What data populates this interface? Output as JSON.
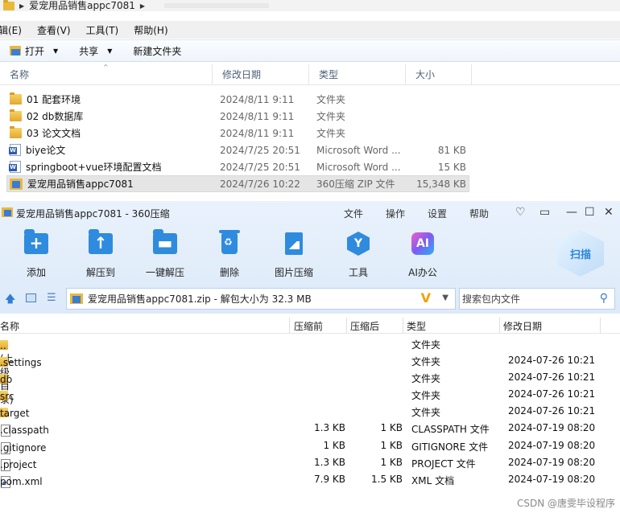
{
  "explorer": {
    "window_path": "爱宠用品销售appc7081",
    "menu": [
      "辑(E)",
      "查看(V)",
      "工具(T)",
      "帮助(H)"
    ],
    "toolbar": {
      "open": "打开",
      "share": "共享",
      "new_folder": "新建文件夹"
    },
    "columns": [
      "名称",
      "修改日期",
      "类型",
      "大小"
    ],
    "files": [
      {
        "name": "01 配套环境",
        "date": "2024/8/11 9:11",
        "type": "文件夹",
        "size": "",
        "icon": "folder-icon"
      },
      {
        "name": "02 db数据库",
        "date": "2024/8/11 9:11",
        "type": "文件夹",
        "size": "",
        "icon": "folder-icon"
      },
      {
        "name": "03 论文文档",
        "date": "2024/8/11 9:11",
        "type": "文件夹",
        "size": "",
        "icon": "folder-icon"
      },
      {
        "name": "biye论文",
        "date": "2024/7/25 20:51",
        "type": "Microsoft Word ...",
        "size": "81 KB",
        "icon": "word-doc-icon"
      },
      {
        "name": "springboot+vue环境配置文档",
        "date": "2024/7/25 20:51",
        "type": "Microsoft Word ...",
        "size": "15 KB",
        "icon": "word-doc-icon"
      },
      {
        "name": "爱宠用品销售appc7081",
        "date": "2024/7/26 10:22",
        "type": "360压缩 ZIP 文件",
        "size": "15,348 KB",
        "icon": "zip-archive-icon",
        "selected": true
      }
    ]
  },
  "zip": {
    "title": "爱宠用品销售appc7081 - 360压缩",
    "menu": [
      "文件",
      "操作",
      "设置",
      "帮助"
    ],
    "tools": [
      {
        "label": "添加",
        "icon": "add-icon"
      },
      {
        "label": "解压到",
        "icon": "extract-to-icon"
      },
      {
        "label": "一键解压",
        "icon": "one-click-extract-icon"
      },
      {
        "label": "删除",
        "icon": "delete-icon"
      },
      {
        "label": "图片压缩",
        "icon": "image-compress-icon"
      },
      {
        "label": "工具",
        "icon": "tools-icon"
      },
      {
        "label": "AI办公",
        "icon": "ai-office-icon"
      }
    ],
    "scan_label": "扫描",
    "address": "爱宠用品销售appc7081.zip - 解包大小为 32.3 MB",
    "search_placeholder": "搜索包内文件",
    "columns": [
      "名称",
      "压缩前",
      "压缩后",
      "类型",
      "修改日期"
    ],
    "entries": [
      {
        "name": ".. (上级目录)",
        "compressed": "",
        "uncompressed": "",
        "type": "文件夹",
        "date": "",
        "icon": "folder-icon"
      },
      {
        "name": ".settings",
        "compressed": "",
        "uncompressed": "",
        "type": "文件夹",
        "date": "2024-07-26 10:21",
        "icon": "folder-icon"
      },
      {
        "name": "db",
        "compressed": "",
        "uncompressed": "",
        "type": "文件夹",
        "date": "2024-07-26 10:21",
        "icon": "folder-icon"
      },
      {
        "name": "src",
        "compressed": "",
        "uncompressed": "",
        "type": "文件夹",
        "date": "2024-07-26 10:21",
        "icon": "folder-icon"
      },
      {
        "name": "target",
        "compressed": "",
        "uncompressed": "",
        "type": "文件夹",
        "date": "2024-07-26 10:21",
        "icon": "folder-icon"
      },
      {
        "name": ".classpath",
        "compressed": "1.3 KB",
        "uncompressed": "1 KB",
        "type": "CLASSPATH 文件",
        "date": "2024-07-19 08:20",
        "icon": "file-icon"
      },
      {
        "name": ".gitignore",
        "compressed": "1 KB",
        "uncompressed": "1 KB",
        "type": "GITIGNORE 文件",
        "date": "2024-07-19 08:20",
        "icon": "file-icon"
      },
      {
        "name": ".project",
        "compressed": "1.3 KB",
        "uncompressed": "1 KB",
        "type": "PROJECT 文件",
        "date": "2024-07-19 08:20",
        "icon": "file-icon"
      },
      {
        "name": "pom.xml",
        "compressed": "7.9 KB",
        "uncompressed": "1.5 KB",
        "type": "XML 文档",
        "date": "2024-07-19 08:20",
        "icon": "xml-file-icon"
      }
    ]
  },
  "watermark": "CSDN @唐雯毕设程序"
}
